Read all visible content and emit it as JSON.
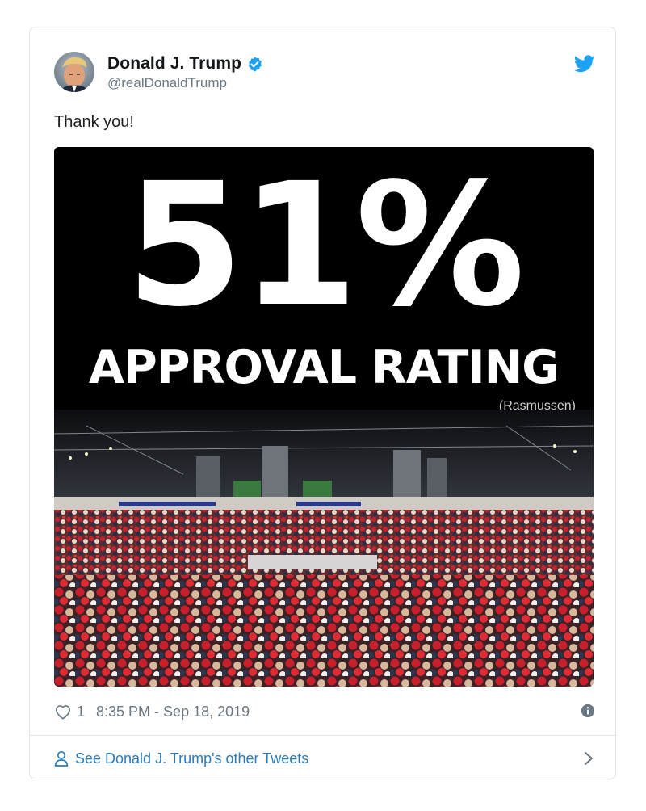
{
  "tweet": {
    "author": {
      "display_name": "Donald J. Trump",
      "handle": "@realDonaldTrump",
      "avatar_icon": "profile-photo",
      "verified_icon": "verified-badge-icon"
    },
    "text": "Thank you!",
    "media": {
      "headline_number": "51%",
      "headline_text": "APPROVAL RATING",
      "source": "(Rasmussen)"
    },
    "likes": "1",
    "timestamp": "8:35 PM - Sep 18, 2019",
    "see_more": "See Donald J. Trump's other Tweets"
  },
  "colors": {
    "brand_blue": "#1da1f2",
    "link_blue": "#2b7bb9",
    "meta_gray": "#697882",
    "text_dark": "#14171a"
  }
}
